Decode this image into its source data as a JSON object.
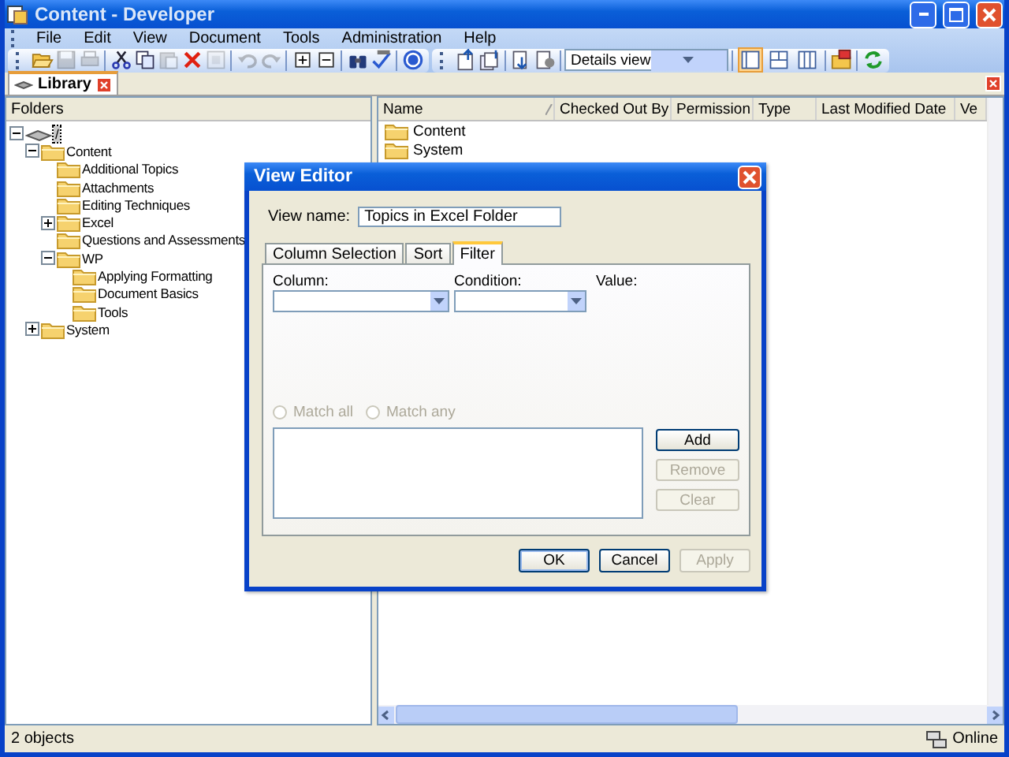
{
  "window": {
    "title": "Content - Developer"
  },
  "menu": [
    {
      "label": "File"
    },
    {
      "label": "Edit"
    },
    {
      "label": "View"
    },
    {
      "label": "Document"
    },
    {
      "label": "Tools"
    },
    {
      "label": "Administration"
    },
    {
      "label": "Help"
    }
  ],
  "toolbar": [
    {
      "kind": "button",
      "disabled": false
    },
    {
      "kind": "button",
      "disabled": true
    },
    {
      "kind": "button",
      "disabled": true
    },
    {
      "kind": "separator"
    },
    {
      "kind": "button",
      "disabled": false
    },
    {
      "kind": "button",
      "disabled": false
    },
    {
      "kind": "button",
      "disabled": true
    },
    {
      "kind": "button",
      "disabled": false
    },
    {
      "kind": "button",
      "disabled": true
    },
    {
      "kind": "separator"
    },
    {
      "kind": "button",
      "disabled": true
    },
    {
      "kind": "button",
      "disabled": true
    },
    {
      "kind": "separator"
    },
    {
      "kind": "button",
      "disabled": false
    },
    {
      "kind": "button",
      "disabled": false
    },
    {
      "kind": "separator"
    },
    {
      "kind": "button",
      "disabled": false
    },
    {
      "kind": "button",
      "disabled": false
    },
    {
      "kind": "separator"
    },
    {
      "kind": "button",
      "disabled": false
    }
  ],
  "toolbar_2": [
    {
      "kind": "button",
      "disabled": false
    },
    {
      "kind": "button",
      "disabled": false
    },
    {
      "kind": "separator"
    },
    {
      "kind": "button",
      "disabled": false
    },
    {
      "kind": "button",
      "disabled": false
    },
    {
      "kind": "separator"
    },
    {
      "kind": "dropdown",
      "value": "Details view"
    },
    {
      "kind": "separator"
    },
    {
      "kind": "view",
      "selected": true
    },
    {
      "kind": "view",
      "selected": false
    },
    {
      "kind": "view",
      "selected": false
    },
    {
      "kind": "separator"
    },
    {
      "kind": "button",
      "disabled": false
    },
    {
      "kind": "separator"
    },
    {
      "kind": "button",
      "disabled": false
    }
  ],
  "doc_tab": {
    "label": "Library",
    "selected": true
  },
  "tree": {
    "header": "Folders",
    "root": {
      "label": "/",
      "selected": true,
      "expanded": true,
      "children": [
        {
          "label": "Content",
          "selected": false,
          "expanded": true,
          "children": [
            {
              "label": "Additional Topics",
              "selected": false
            },
            {
              "label": "Attachments",
              "selected": false
            },
            {
              "label": "Editing Techniques",
              "selected": false
            },
            {
              "label": "Excel",
              "selected": false,
              "expanded": false
            },
            {
              "label": "Questions and Assessments",
              "selected": false
            },
            {
              "label": "WP",
              "selected": false,
              "expanded": true,
              "children": [
                {
                  "label": "Applying Formatting",
                  "selected": false
                },
                {
                  "label": "Document Basics",
                  "selected": false
                },
                {
                  "label": "Tools",
                  "selected": false
                }
              ]
            }
          ]
        },
        {
          "label": "System",
          "selected": false,
          "expanded": false
        }
      ]
    }
  },
  "list": {
    "columns": [
      {
        "label": "Name",
        "sorted": true
      },
      {
        "label": "Checked Out By",
        "sorted": false
      },
      {
        "label": "Permission",
        "sorted": false
      },
      {
        "label": "Type",
        "sorted": false
      },
      {
        "label": "Last Modified Date",
        "sorted": false
      },
      {
        "label": "Ve",
        "sorted": false
      }
    ],
    "rows": [
      {
        "name": "Content",
        "selected": false
      },
      {
        "name": "System",
        "selected": false
      }
    ]
  },
  "dialog": {
    "title": "View Editor",
    "view_name_label": "View name:",
    "view_name": "Topics in Excel Folder",
    "tabs": [
      {
        "label": "Column Selection",
        "selected": false
      },
      {
        "label": "Sort",
        "selected": false
      },
      {
        "label": "Filter",
        "selected": true
      }
    ],
    "column_label": "Column:",
    "condition_label": "Condition:",
    "value_label": "Value:",
    "radios": [
      {
        "label": "Match all",
        "checked": false,
        "disabled": true
      },
      {
        "label": "Match any",
        "checked": false,
        "disabled": true
      }
    ],
    "side_buttons": [
      {
        "label": "Add",
        "disabled": false
      },
      {
        "label": "Remove",
        "disabled": true
      },
      {
        "label": "Clear",
        "disabled": true
      }
    ],
    "buttons": [
      {
        "label": "OK",
        "disabled": false,
        "default": true
      },
      {
        "label": "Cancel",
        "disabled": false,
        "default": false
      },
      {
        "label": "Apply",
        "disabled": true,
        "default": false
      }
    ]
  },
  "status_bar": {
    "text": "2 objects",
    "connection": "Online"
  }
}
